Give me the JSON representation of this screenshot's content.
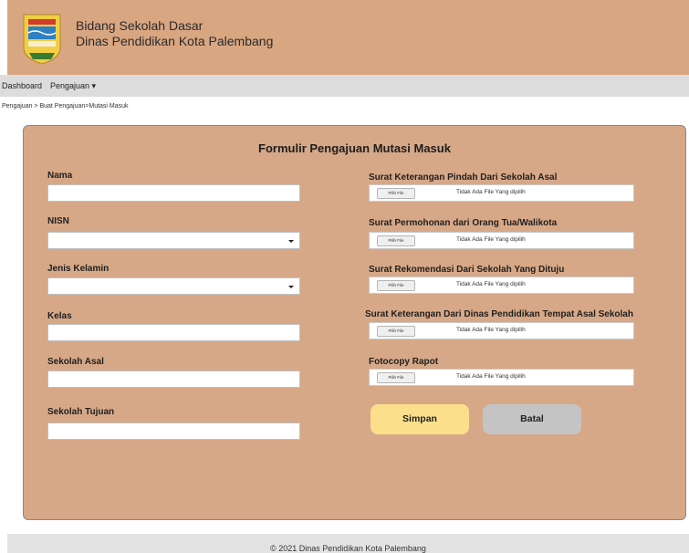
{
  "header": {
    "line1": "Bidang Sekolah Dasar",
    "line2": "Dinas Pendidikan Kota Palembang"
  },
  "nav": {
    "dashboard": "Dashboard",
    "pengajuan": "Pengajuan ▾"
  },
  "breadcrumb": "Pengajuan > Buat Pengajuan>Mutasi Masuk",
  "form": {
    "title": "Formulir Pengajuan Mutasi Masuk",
    "fields": {
      "nama": "Nama",
      "nisn": "NISN",
      "jenis_kelamin": "Jenis Kelamin",
      "kelas": "Kelas",
      "sekolah_asal": "Sekolah Asal",
      "sekolah_tujuan": "Sekolah Tujuan"
    },
    "files": {
      "f1": "Surat Keterangan Pindah Dari Sekolah Asal",
      "f2": "Surat Permohonan dari Orang Tua/Walikota",
      "f3": "Surat Rekomendasi Dari Sekolah Yang Dituju",
      "f4": "Surat Keterangan Dari Dinas Pendidikan Tempat Asal Sekolah",
      "f5": "Fotocopy Rapot"
    },
    "file_button": "Pilih File",
    "file_status": "Tidak Ada File Yang dipilih",
    "save": "Simpan",
    "cancel": "Batal"
  },
  "footer": "© 2021 Dinas Pendidikan Kota Palembang",
  "colors": {
    "header_bg": "#d9a682",
    "panel_bg": "#d7a887",
    "save_button": "#fbdf8b",
    "cancel_button": "#c4c4c4"
  }
}
